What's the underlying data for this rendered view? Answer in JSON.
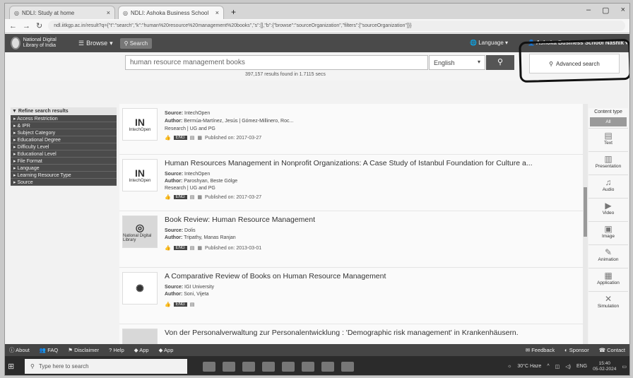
{
  "browser": {
    "tabs": [
      {
        "label": "NDLI: Study at home",
        "active": false
      },
      {
        "label": "NDLI: Ashoka Business School",
        "active": true
      }
    ],
    "url": "ndl.iitkgp.ac.in/result?q={\"t\":\"search\",\"k\":\"human%20resource%20management%20books\",\"s\":[],\"b\":{\"browse\":\"sourceOrganization\",\"filters\":[\"sourceOrganization\"]}}"
  },
  "header": {
    "logo_text": "National Digital Library of India",
    "browse_label": "Browse",
    "search_label": "Search",
    "language_label": "Language",
    "institution_label": "Ashoka Business School Nashik"
  },
  "search": {
    "query": "human resource management books",
    "language": "English",
    "result_count": "397,157 results found in 1.7115 secs",
    "advanced_label": "Advanced search"
  },
  "sidebar": {
    "title": "Refine search results",
    "items": [
      "Access Restriction",
      "& IPR",
      "Subject Category",
      "Educational Degree",
      "Difficulty Level",
      "Educational Level",
      "File Format",
      "Language",
      "Learning Resource Type",
      "Source"
    ]
  },
  "results": [
    {
      "title": "",
      "source_label": "Source:",
      "source": "IntechOpen",
      "author_label": "Author:",
      "author": "Bermúa-Martínez, Jesús | Gómez-Millinero, Roc...",
      "type": "Research  |  UG and PG",
      "published": "Published on: 2017-03-27",
      "thumb": "IntechOpen"
    },
    {
      "title": "Human Resources Management in Nonprofit Organizations: A Case Study of Istanbul Foundation for Culture a...",
      "source_label": "Source:",
      "source": "IntechOpen",
      "author_label": "Author:",
      "author": "Paroshyan, Beste Gölge",
      "type": "Research  |  UG and PG",
      "published": "Published on: 2017-03-27",
      "thumb": "IntechOpen"
    },
    {
      "title": "Book Review: Human Resource Management",
      "source_label": "Source:",
      "source": "Dolis",
      "author_label": "Author:",
      "author": "Tripathy, Manas Ranjan",
      "type": "",
      "published": "Published on: 2013-03-01",
      "thumb": "National Digital Library"
    },
    {
      "title": "A Comparative Review of Books on Human Resource Management",
      "source_label": "Source:",
      "source": "IGI University",
      "author_label": "Author:",
      "author": "Soni, Vijeta",
      "type": "",
      "published": "",
      "thumb": ""
    },
    {
      "title": "Von der Personalverwaltung zur Personalentwicklung : 'Demographic risk management' in Krankenhäusern.",
      "source_label": "",
      "source": "",
      "author_label": "",
      "author": "",
      "type": "",
      "published": "",
      "thumb": ""
    }
  ],
  "content_type": {
    "title": "Content type",
    "all_label": "All",
    "items": [
      "Text",
      "Presentation",
      "Audio",
      "Video",
      "Image",
      "Animation",
      "Application",
      "Simulation"
    ]
  },
  "footer": {
    "left": [
      "About",
      "FAQ",
      "Disclaimer",
      "Help",
      "App",
      "App"
    ],
    "right": [
      "Feedback",
      "Sponsor",
      "Contact"
    ]
  },
  "taskbar": {
    "search_placeholder": "Type here to search",
    "weather": "30°C Haze",
    "lang": "ENG",
    "time": "15:40",
    "date": "05-02-2024"
  }
}
